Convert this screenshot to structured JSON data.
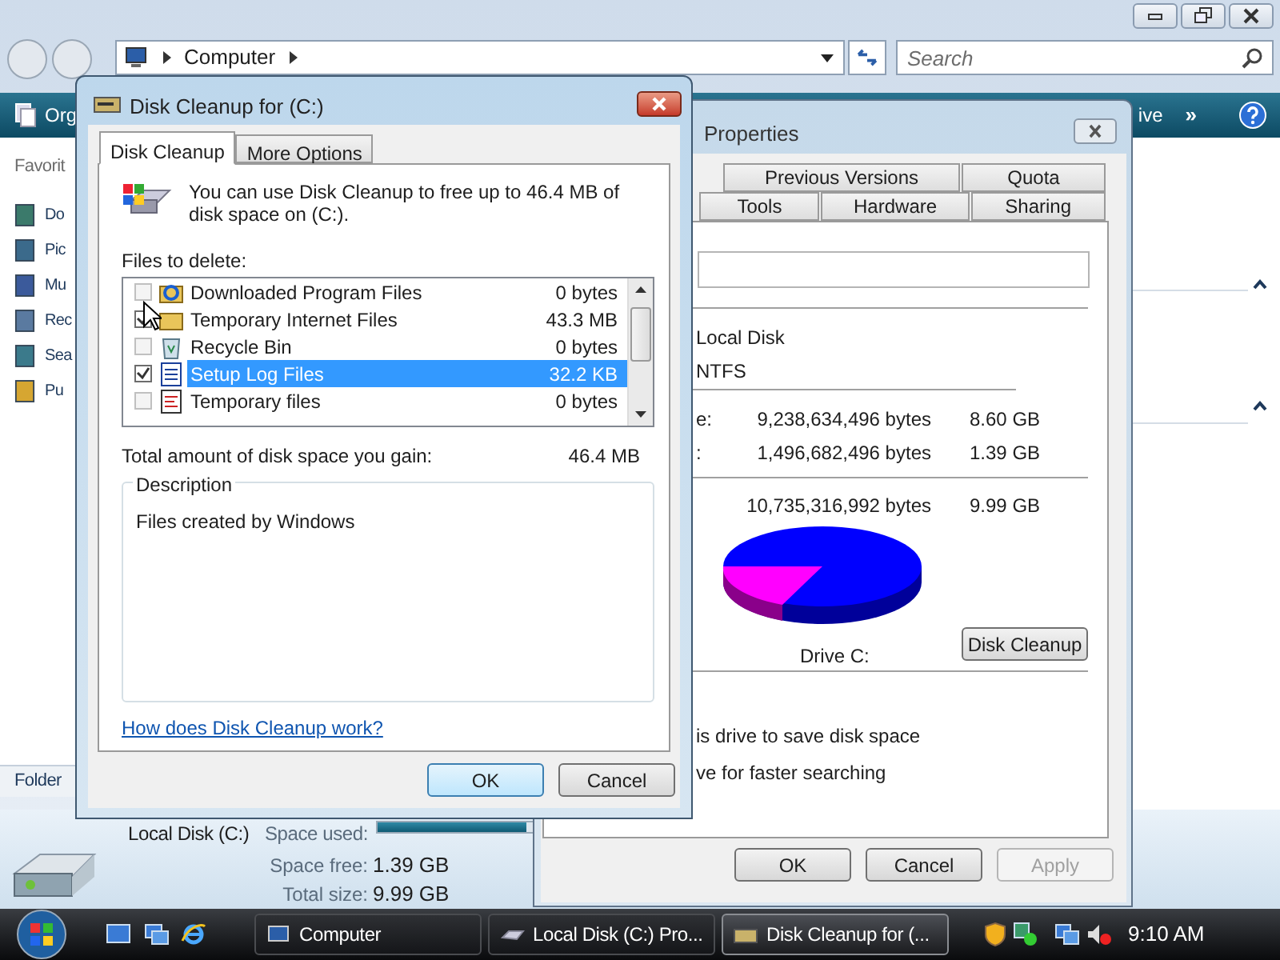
{
  "explorer": {
    "address": {
      "path": [
        "Computer"
      ]
    },
    "search": {
      "placeholder": "Search"
    },
    "toolbar": {
      "items": [
        "Org",
        "ive"
      ],
      "more": "»"
    },
    "nav": {
      "heading": "Favorit",
      "items": [
        "Do",
        "Pic",
        "Mu",
        "Rec",
        "Sea",
        "Pu"
      ]
    },
    "folders_label": "Folder",
    "details": {
      "name": "Local Disk (C:)",
      "space_used_label": "Space used:",
      "space_used_bar": {
        "level": 0.86
      },
      "space_free_label": "Space free:",
      "space_free": "1.39 GB",
      "total_size_label": "Total size:",
      "total_size": "9.99 GB"
    }
  },
  "properties": {
    "title": "Properties",
    "tab_rows": [
      [
        {
          "label": "Previous Versions",
          "selected": false
        },
        {
          "label": "Quota",
          "selected": false
        }
      ],
      [
        {
          "label": "Tools",
          "selected": false
        },
        {
          "label": "Hardware",
          "selected": false
        },
        {
          "label": "Sharing",
          "selected": false
        }
      ]
    ],
    "type_value": "Local Disk",
    "fs_value": "NTFS",
    "space_rows": [
      {
        "label": "e:",
        "bytes": "9,238,634,496 bytes",
        "size": "8.60 GB"
      },
      {
        "label": ":",
        "bytes": "1,496,682,496 bytes",
        "size": "1.39 GB"
      },
      {
        "bytes": "10,735,316,992 bytes",
        "size": "9.99 GB"
      }
    ],
    "drive_label": "Drive C:",
    "cleanup_button": "Disk Cleanup",
    "options": [
      "is drive to save disk space",
      "ve for faster searching"
    ],
    "buttons": [
      {
        "label": "OK",
        "disabled": false
      },
      {
        "label": "Cancel",
        "disabled": false
      },
      {
        "label": "Apply",
        "disabled": true
      }
    ]
  },
  "cleanup": {
    "title": "Disk Cleanup for  (C:)",
    "tabs": [
      {
        "label": "Disk Cleanup",
        "selected": true
      },
      {
        "label": "More Options",
        "selected": false
      }
    ],
    "intro": "You can use Disk Cleanup to free up to 46.4 MB of disk space on  (C:).",
    "files_label": "Files to delete:",
    "files": [
      {
        "name": "Downloaded Program Files",
        "size": "0 bytes",
        "checked": false,
        "selected": false
      },
      {
        "name": "Temporary Internet Files",
        "size": "43.3 MB",
        "checked": true,
        "selected": false
      },
      {
        "name": "Recycle Bin",
        "size": "0 bytes",
        "checked": false,
        "selected": false
      },
      {
        "name": "Setup Log Files",
        "size": "32.2 KB",
        "checked": true,
        "selected": true
      },
      {
        "name": "Temporary files",
        "size": "0 bytes",
        "checked": false,
        "selected": false
      }
    ],
    "total_label": "Total amount of disk space you gain:",
    "total_value": "46.4 MB",
    "description_legend": "Description",
    "description": "Files created by Windows",
    "link": "How does Disk Cleanup work?",
    "buttons": [
      {
        "label": "OK",
        "default": true
      },
      {
        "label": "Cancel",
        "default": false
      }
    ]
  },
  "taskbar": {
    "buttons": [
      {
        "label": "Computer",
        "selected": false
      },
      {
        "label": "Local Disk (C:) Pro...",
        "selected": false
      },
      {
        "label": "Disk Cleanup for  (...",
        "selected": true
      }
    ],
    "clock": "9:10 AM"
  }
}
